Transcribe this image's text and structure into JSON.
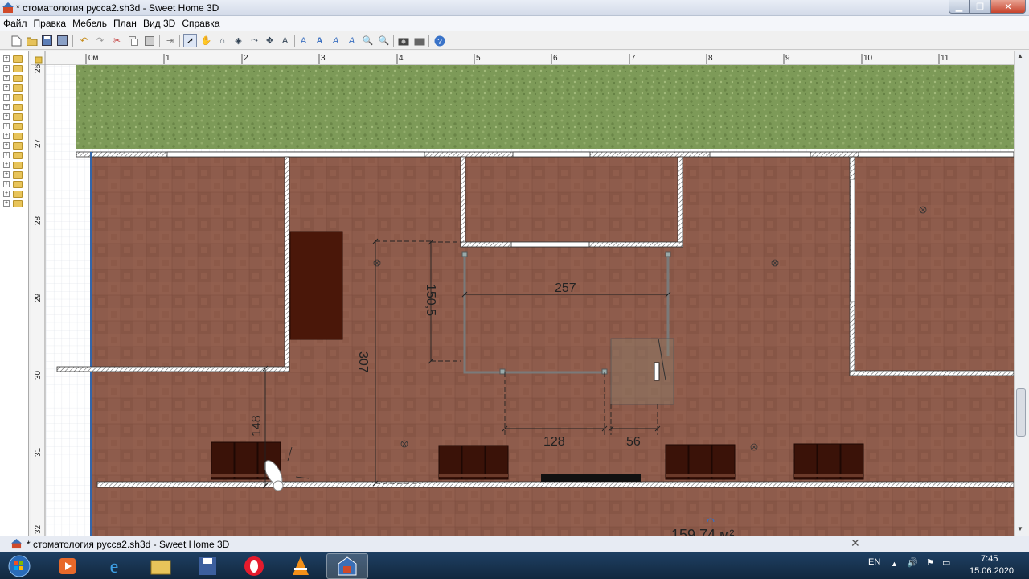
{
  "window": {
    "title": "* стоматология русса2.sh3d - Sweet Home 3D"
  },
  "menu": [
    "Файл",
    "Правка",
    "Мебель",
    "План",
    "Вид 3D",
    "Справка"
  ],
  "toolbar": {
    "icons": [
      "new-icon",
      "open-icon",
      "save-icon",
      "save-as-icon",
      "undo-icon",
      "redo-icon",
      "cut-icon",
      "copy-icon",
      "paste-icon",
      "add-furniture-icon",
      "select-icon",
      "pan-icon",
      "create-walls-icon",
      "create-rooms-icon",
      "create-polylines-icon",
      "create-dimensions-icon",
      "create-labels-icon",
      "text-style-icon",
      "text-bold-icon",
      "text-italic-icon",
      "text-size-icon",
      "zoom-in-icon",
      "zoom-out-icon",
      "photo-icon",
      "video-icon",
      "help-icon"
    ]
  },
  "ruler": {
    "h_labels": [
      "0м",
      "1",
      "2",
      "3",
      "4",
      "5",
      "6",
      "7",
      "8",
      "9",
      "10",
      "11"
    ],
    "v_labels": [
      "26",
      "27",
      "28",
      "29",
      "30",
      "31",
      "32"
    ]
  },
  "plan": {
    "dimensions": {
      "d1": "150,5",
      "d2": "257",
      "d3": "307",
      "d4": "148",
      "d5": "128",
      "d6": "56"
    },
    "area_label": "159,74 м²"
  },
  "bottom_panel": {
    "title": "* стоматология русса2.sh3d - Sweet Home 3D",
    "close": "✕"
  },
  "taskbar": {
    "apps": [
      "vlc-like-media-icon",
      "internet-explorer-icon",
      "explorer-icon",
      "save-disk-icon",
      "opera-icon",
      "vlc-icon",
      "sweet-home-3d-icon"
    ],
    "lang": "EN",
    "time": "7:45",
    "date": "15.06.2020"
  },
  "colors": {
    "grass": "#7e9a5a",
    "floor": "#8c5a4a",
    "wall_fill": "#ffffff",
    "dark_furniture": "#3a1208"
  }
}
